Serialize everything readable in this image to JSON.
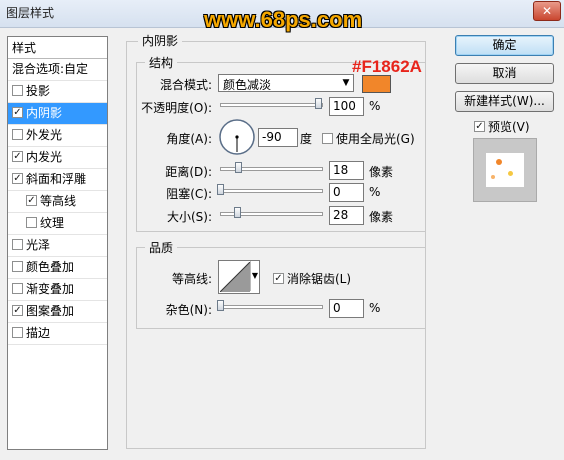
{
  "window": {
    "title": "图层样式",
    "watermark": "www.68ps.com",
    "close": "✕"
  },
  "left_panel": {
    "header": "样式",
    "items": [
      {
        "label": "混合选项:自定",
        "checkbox": false,
        "checked": false,
        "selected": false
      },
      {
        "label": "投影",
        "checkbox": true,
        "checked": false,
        "selected": false
      },
      {
        "label": "内阴影",
        "checkbox": true,
        "checked": true,
        "selected": true
      },
      {
        "label": "外发光",
        "checkbox": true,
        "checked": false,
        "selected": false
      },
      {
        "label": "内发光",
        "checkbox": true,
        "checked": true,
        "selected": false
      },
      {
        "label": "斜面和浮雕",
        "checkbox": true,
        "checked": true,
        "selected": false
      },
      {
        "label": "等高线",
        "checkbox": true,
        "checked": true,
        "selected": false,
        "indent": true
      },
      {
        "label": "纹理",
        "checkbox": true,
        "checked": false,
        "selected": false,
        "indent": true
      },
      {
        "label": "光泽",
        "checkbox": true,
        "checked": false,
        "selected": false
      },
      {
        "label": "颜色叠加",
        "checkbox": true,
        "checked": false,
        "selected": false
      },
      {
        "label": "渐变叠加",
        "checkbox": true,
        "checked": false,
        "selected": false
      },
      {
        "label": "图案叠加",
        "checkbox": true,
        "checked": true,
        "selected": false
      },
      {
        "label": "描边",
        "checkbox": true,
        "checked": false,
        "selected": false
      }
    ]
  },
  "inner_shadow": {
    "title": "内阴影",
    "structure": {
      "title": "结构",
      "blend_mode_label": "混合模式:",
      "blend_mode_value": "颜色减淡",
      "color": "#F1862A",
      "color_annotation": "#F1862A",
      "opacity_label": "不透明度(O):",
      "opacity_value": "100",
      "opacity_unit": "%",
      "angle_label": "角度(A):",
      "angle_value": "-90",
      "angle_unit": "度",
      "global_light_label": "使用全局光(G)",
      "distance_label": "距离(D):",
      "distance_value": "18",
      "distance_unit": "像素",
      "choke_label": "阻塞(C):",
      "choke_value": "0",
      "choke_unit": "%",
      "size_label": "大小(S):",
      "size_value": "28",
      "size_unit": "像素"
    },
    "quality": {
      "title": "品质",
      "contour_label": "等高线:",
      "antialias_label": "消除锯齿(L)",
      "noise_label": "杂色(N):",
      "noise_value": "0",
      "noise_unit": "%"
    }
  },
  "buttons": {
    "ok": "确定",
    "cancel": "取消",
    "new_style": "新建样式(W)...",
    "preview_label": "预览(V)"
  }
}
